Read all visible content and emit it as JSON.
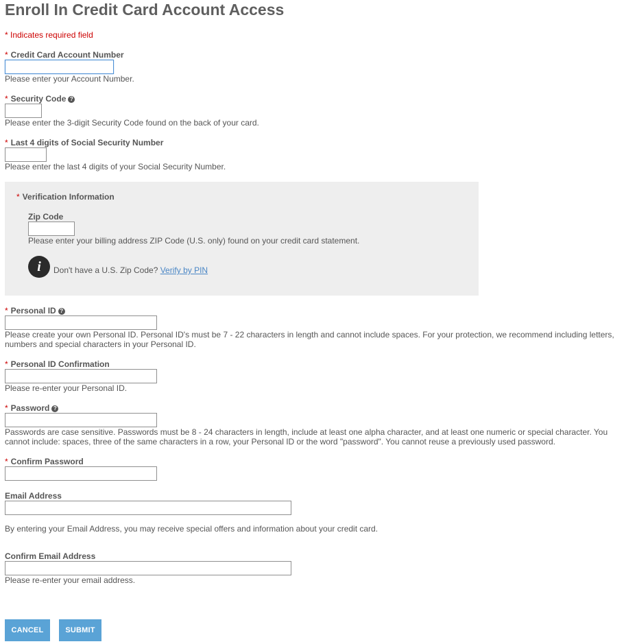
{
  "page": {
    "title": "Enroll In Credit Card Account Access"
  },
  "required_note": "* Indicates required field",
  "required_marker": "*",
  "fields": {
    "account_number": {
      "label": "Credit Card Account Number",
      "value": "",
      "help": "Please enter your Account Number."
    },
    "security_code": {
      "label": "Security Code",
      "value": "",
      "help": "Please enter the 3-digit Security Code found on the back of your card."
    },
    "ssn_last4": {
      "label": "Last 4 digits of Social Security Number",
      "value": "",
      "help": "Please enter the last 4 digits of your Social Security Number."
    },
    "personal_id": {
      "label": "Personal ID",
      "value": "",
      "help": "Please create your own Personal ID.  Personal ID's must be 7 - 22 characters in length and cannot include spaces.  For your protection, we recommend including letters, numbers and special characters in your Personal ID."
    },
    "personal_id_confirm": {
      "label": "Personal ID Confirmation",
      "value": "",
      "help": "Please re-enter your Personal ID."
    },
    "password": {
      "label": "Password",
      "value": "",
      "help": "Passwords are case sensitive. Passwords must be 8 - 24 characters in length, include at least one alpha character, and at least one numeric or special character.  You cannot include: spaces, three of the same characters in a row, your Personal ID or the word \"password\". You cannot reuse a previously used password."
    },
    "password_confirm": {
      "label": "Confirm Password",
      "value": ""
    },
    "email": {
      "label": "Email Address",
      "value": "",
      "help": "By entering your Email Address, you may receive special offers and information about your credit card."
    },
    "email_confirm": {
      "label": "Confirm Email Address",
      "value": "",
      "help": "Please re-enter your email address."
    }
  },
  "verification": {
    "heading": "Verification Information",
    "zip_label": "Zip Code",
    "zip_value": "",
    "zip_help": "Please enter your billing address ZIP Code (U.S. only) found on your credit card statement.",
    "no_zip_text": "Don't have a U.S. Zip Code?",
    "verify_link": "Verify by PIN",
    "info_icon_glyph": "i"
  },
  "help_icon_glyph": "?",
  "buttons": {
    "cancel": "CANCEL",
    "submit": "SUBMIT"
  },
  "colors": {
    "required": "#cc0000",
    "button": "#5aa3d6",
    "link": "#4a86c5",
    "panel": "#eeeeee"
  }
}
